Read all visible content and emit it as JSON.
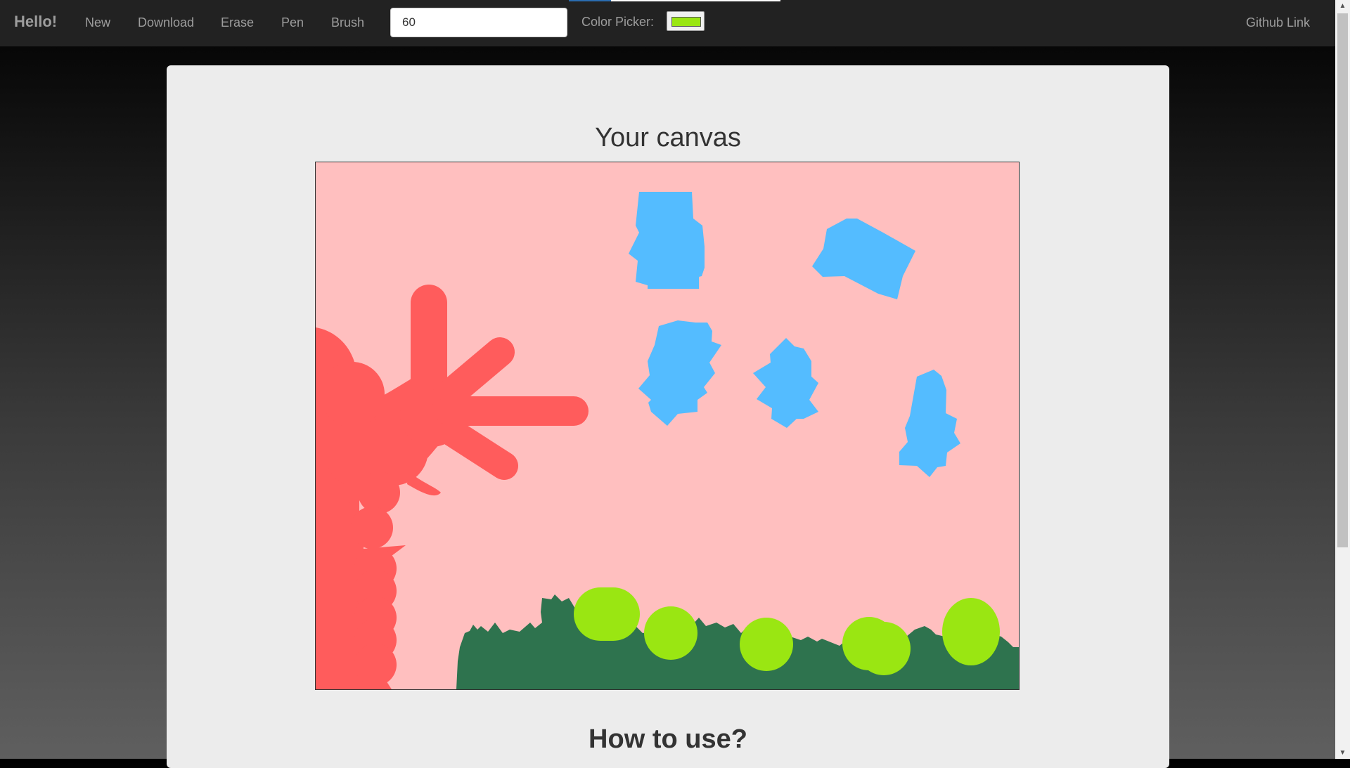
{
  "navbar": {
    "brand": "Hello!",
    "links": [
      "New",
      "Download",
      "Erase",
      "Pen",
      "Brush"
    ],
    "size_value": "60",
    "color_picker_label": "Color Picker:",
    "github_link": "Github Link"
  },
  "color_picker": {
    "selected_color": "#9ae612"
  },
  "canvas": {
    "title": "Your canvas",
    "background_color": "#ffbfbf",
    "tree_color": "#ff5c5c",
    "cloud_color": "#54bcff",
    "grass_color": "#2e734e",
    "bush_color": "#9ae612"
  },
  "howto": {
    "title": "How to use?"
  }
}
